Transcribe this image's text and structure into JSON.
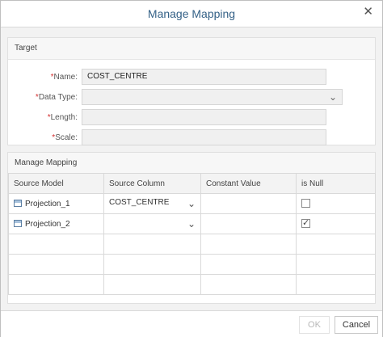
{
  "dialog": {
    "title": "Manage Mapping",
    "close_icon": "close-icon"
  },
  "target": {
    "header": "Target",
    "name_label": "Name:",
    "name_value": "COST_CENTRE",
    "datatype_label": "Data Type:",
    "datatype_value": "",
    "length_label": "Length:",
    "length_value": "",
    "scale_label": "Scale:",
    "scale_value": "",
    "required_marker": "*"
  },
  "mapping": {
    "header": "Manage Mapping",
    "columns": [
      "Source Model",
      "Source Column",
      "Constant Value",
      "is Null"
    ],
    "rows": [
      {
        "model": "Projection_1",
        "column": "COST_CENTRE",
        "constant": "",
        "is_null": false
      },
      {
        "model": "Projection_2",
        "column": "",
        "constant": "",
        "is_null": true
      }
    ]
  },
  "footer": {
    "ok_label": "OK",
    "cancel_label": "Cancel"
  }
}
